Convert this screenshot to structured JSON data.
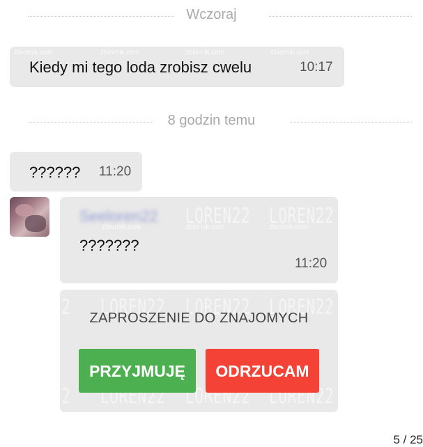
{
  "dividers": {
    "yesterday": "Wczoraj",
    "hours_ago": "8 godzin temu"
  },
  "messages": [
    {
      "text": "Kiedy mi tego loda zrobisz cwelu",
      "time": "10:17"
    },
    {
      "text": "??????",
      "time": "11:20"
    },
    {
      "sender": "Seeloren22",
      "text": "???????",
      "time": "11:20"
    }
  ],
  "invite": {
    "title": "ZAPROSZENIE DO ZNAJOMYCH",
    "accept_label": "PRZYJMUJĘ",
    "reject_label": "ODRZUCAM"
  },
  "watermarks": {
    "site": "zbiornik.com",
    "brand": "LOREN22",
    "brand_fragment": "2"
  },
  "page_counter": "5 / 25",
  "colors": {
    "accept": "#4caf50",
    "reject": "#f44336",
    "bubble": "#e9e9e9"
  }
}
